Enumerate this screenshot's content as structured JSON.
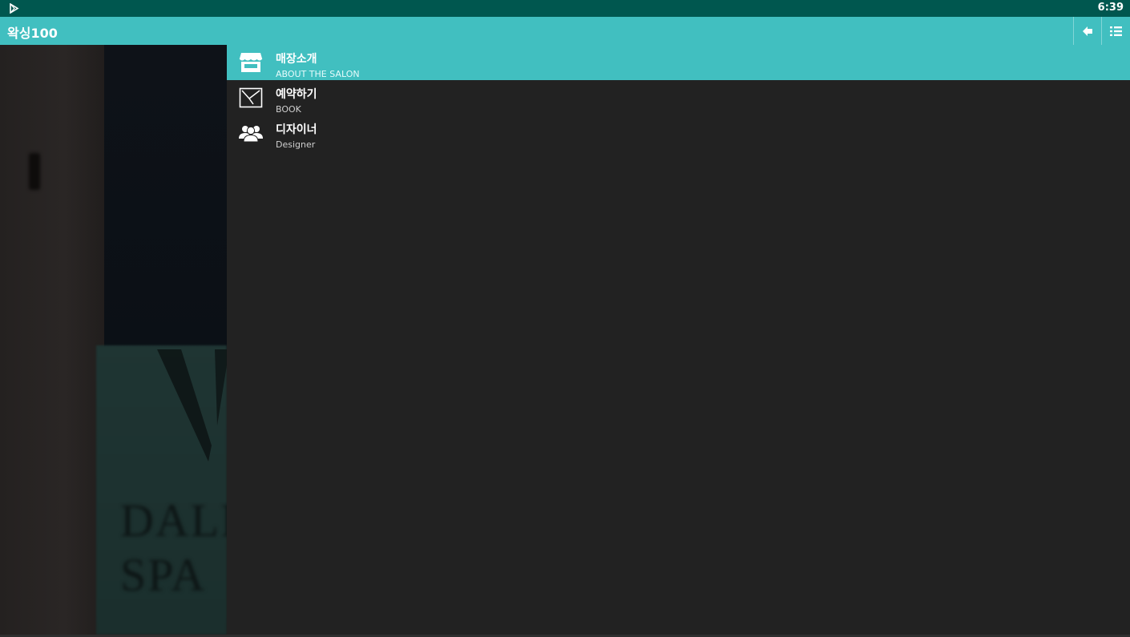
{
  "statusbar": {
    "time": "6:39",
    "app_icon": "play-store-icon"
  },
  "appbar": {
    "title": "왁싱100",
    "back_icon": "back-arrow-icon",
    "menu_icon": "list-menu-icon"
  },
  "image_panel": {
    "visible_text": [
      "DALI",
      "SPA"
    ]
  },
  "menu": {
    "items": [
      {
        "label": "매장소개",
        "sublabel": "ABOUT THE SALON",
        "icon": "storefront-icon",
        "active": true
      },
      {
        "label": "예약하기",
        "sublabel": "BOOK",
        "icon": "clock-icon",
        "active": false
      },
      {
        "label": "디자이너",
        "sublabel": "Designer",
        "icon": "users-icon",
        "active": false
      }
    ]
  },
  "colors": {
    "accent": "#41bfc0",
    "statusbar": "#00574f",
    "background": "#222222"
  }
}
